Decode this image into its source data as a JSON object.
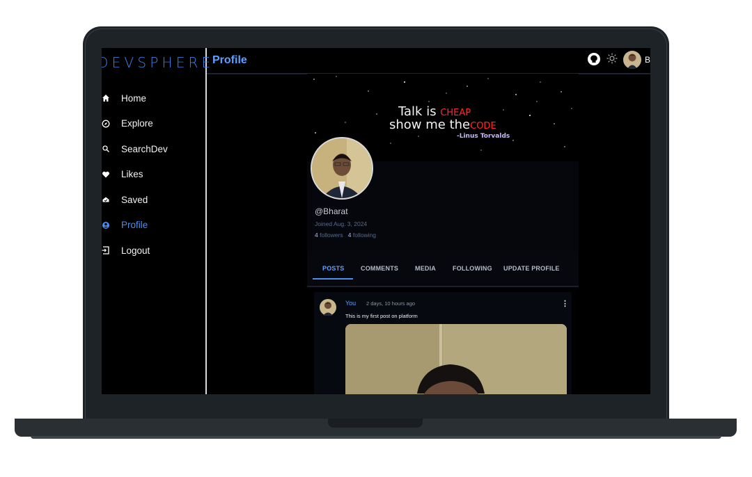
{
  "brand": "DEVSPHERE",
  "nav": [
    {
      "label": "Home",
      "icon": "home-icon"
    },
    {
      "label": "Explore",
      "icon": "compass-icon"
    },
    {
      "label": "SearchDev",
      "icon": "search-icon"
    },
    {
      "label": "Likes",
      "icon": "heart-icon"
    },
    {
      "label": "Saved",
      "icon": "saved-icon"
    },
    {
      "label": "Profile",
      "icon": "user-icon",
      "active": true
    },
    {
      "label": "Logout",
      "icon": "logout-icon"
    }
  ],
  "header": {
    "title": "Profile",
    "user_initial": "B"
  },
  "banner": {
    "line1_a": "Talk is ",
    "line1_b": "CHEAP",
    "line2_a": "show me the",
    "line2_b": "CODE",
    "author": "-Linus Torvalds"
  },
  "profile": {
    "handle": "@Bharat",
    "joined": "Joined Aug. 3, 2024",
    "followers_count": "4",
    "followers_label": "followers",
    "following_count": "4",
    "following_label": "following"
  },
  "tabs": [
    "POSTS",
    "COMMENTS",
    "MEDIA",
    "FOLLOWING",
    "UPDATE PROFILE"
  ],
  "post": {
    "author": "You",
    "time": "2 days, 10 hours ago",
    "text": "This is my first post on platform",
    "menu": "⋮"
  },
  "colors": {
    "accent": "#4c8df0",
    "title": "#5ea0ff",
    "bg": "#000000",
    "red": "#ff2a2a"
  }
}
